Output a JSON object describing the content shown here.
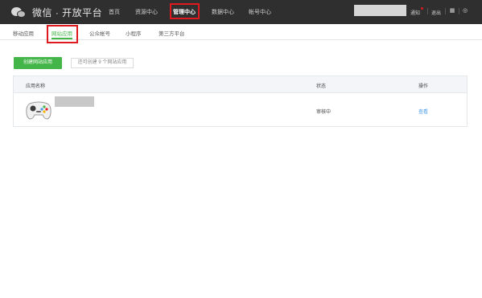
{
  "header": {
    "logo_title": "微信 · 开放平台",
    "nav": [
      {
        "label": "首页"
      },
      {
        "label": "资源中心"
      },
      {
        "label": "管理中心"
      },
      {
        "label": "数据中心"
      },
      {
        "label": "帐号中心"
      }
    ],
    "active_nav": "管理中心",
    "notify_label": "通知",
    "logout_label": "退出"
  },
  "subnav": {
    "tabs": [
      {
        "label": "移动应用"
      },
      {
        "label": "网站应用"
      },
      {
        "label": "公众帐号"
      },
      {
        "label": "小程序"
      },
      {
        "label": "第三方平台"
      }
    ],
    "active_tab": "网站应用"
  },
  "actions": {
    "create_label": "创建网站应用",
    "remaining_label": "还可创建 9 个网站应用"
  },
  "table": {
    "headers": {
      "name": "应用名称",
      "status": "状态",
      "action": "操作"
    },
    "rows": [
      {
        "status": "审核中",
        "action": "查看"
      }
    ]
  },
  "colors": {
    "topbar": "#2f2f2f",
    "accent": "#44b549",
    "highlight": "#e0191f",
    "link": "#459ae9"
  }
}
